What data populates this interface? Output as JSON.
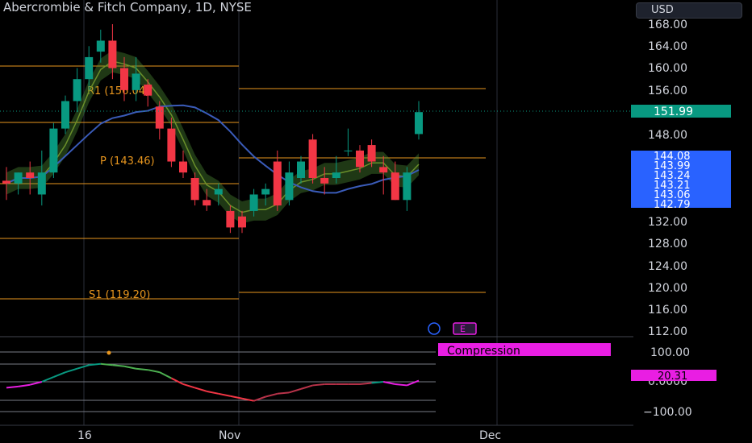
{
  "title": "Abercrombie & Fitch Company, 1D, NYSE",
  "currency": "USD",
  "colors": {
    "up": "#089981",
    "down": "#f23645",
    "pivot": "#e8961e",
    "blue_price": "#2962ff",
    "green_price": "#089981",
    "magenta": "#e91ee3",
    "axis_text": "#d1d4dc",
    "grid_line": "#2a2e39"
  },
  "price_axis": {
    "ticks": [
      "168.00",
      "164.00",
      "160.00",
      "156.00",
      "148.00",
      "132.00",
      "128.00",
      "124.00",
      "120.00",
      "116.00",
      "112.00"
    ],
    "current_price_label": "151.99",
    "stack_labels": [
      "144.08",
      "143.99",
      "143.24",
      "143.21",
      "143.06",
      "142.79"
    ]
  },
  "osc_axis": {
    "ticks": [
      "100.00",
      "0.0000",
      "−100.00"
    ],
    "value_label": "20.31"
  },
  "time_axis": {
    "labels": [
      "16",
      "Nov",
      "Dec"
    ]
  },
  "pivots": {
    "r1_label": "R1 (156.04)",
    "p_label": "P (143.46)",
    "s1_label": "S1 (119.20)"
  },
  "compression_label": "Compression",
  "event_badge": "E",
  "chart_data": {
    "type": "candlestick",
    "ylim": [
      110,
      170
    ],
    "candles": [
      {
        "o": 139.5,
        "h": 142,
        "l": 136,
        "c": 139
      },
      {
        "o": 139,
        "h": 141,
        "l": 137,
        "c": 141
      },
      {
        "o": 141,
        "h": 143,
        "l": 137,
        "c": 140
      },
      {
        "o": 137,
        "h": 145,
        "l": 135,
        "c": 141
      },
      {
        "o": 141,
        "h": 150,
        "l": 140,
        "c": 149
      },
      {
        "o": 149,
        "h": 155,
        "l": 148,
        "c": 154
      },
      {
        "o": 154,
        "h": 160,
        "l": 152,
        "c": 158
      },
      {
        "o": 158,
        "h": 164,
        "l": 156,
        "c": 162
      },
      {
        "o": 163,
        "h": 167,
        "l": 161,
        "c": 165
      },
      {
        "o": 165,
        "h": 168,
        "l": 158,
        "c": 160
      },
      {
        "o": 160,
        "h": 162,
        "l": 154,
        "c": 156
      },
      {
        "o": 156,
        "h": 162,
        "l": 154,
        "c": 159
      },
      {
        "o": 157,
        "h": 158,
        "l": 153,
        "c": 155
      },
      {
        "o": 153,
        "h": 154,
        "l": 147,
        "c": 149
      },
      {
        "o": 149,
        "h": 151,
        "l": 142,
        "c": 143
      },
      {
        "o": 143,
        "h": 145,
        "l": 140,
        "c": 141
      },
      {
        "o": 140,
        "h": 141,
        "l": 135,
        "c": 136
      },
      {
        "o": 136,
        "h": 138,
        "l": 134,
        "c": 135
      },
      {
        "o": 137,
        "h": 139,
        "l": 135,
        "c": 138
      },
      {
        "o": 134,
        "h": 135,
        "l": 130,
        "c": 131
      },
      {
        "o": 133,
        "h": 134,
        "l": 130,
        "c": 131
      },
      {
        "o": 134,
        "h": 138,
        "l": 133,
        "c": 137
      },
      {
        "o": 137,
        "h": 139,
        "l": 135,
        "c": 138
      },
      {
        "o": 143,
        "h": 145,
        "l": 134,
        "c": 135
      },
      {
        "o": 136,
        "h": 143,
        "l": 135,
        "c": 141
      },
      {
        "o": 140,
        "h": 144,
        "l": 139,
        "c": 143
      },
      {
        "o": 147,
        "h": 148,
        "l": 139,
        "c": 140
      },
      {
        "o": 140,
        "h": 142,
        "l": 137,
        "c": 139
      },
      {
        "o": 140,
        "h": 144,
        "l": 139,
        "c": 141
      },
      {
        "o": 145,
        "h": 149,
        "l": 144,
        "c": 145
      },
      {
        "o": 145,
        "h": 146,
        "l": 141,
        "c": 142
      },
      {
        "o": 146,
        "h": 147,
        "l": 142,
        "c": 143
      },
      {
        "o": 142,
        "h": 144,
        "l": 137,
        "c": 141
      },
      {
        "o": 141,
        "h": 143,
        "l": 136,
        "c": 136
      },
      {
        "o": 136,
        "h": 142,
        "l": 134,
        "c": 141
      },
      {
        "o": 148,
        "h": 154,
        "l": 147,
        "c": 151.99
      }
    ],
    "oscillator": [
      40,
      42,
      45,
      50,
      58,
      66,
      72,
      78,
      80,
      78,
      76,
      72,
      70,
      66,
      56,
      46,
      40,
      34,
      30,
      26,
      22,
      18,
      25,
      30,
      32,
      38,
      44,
      46,
      46,
      46,
      46,
      48,
      50,
      46,
      44,
      52
    ]
  }
}
